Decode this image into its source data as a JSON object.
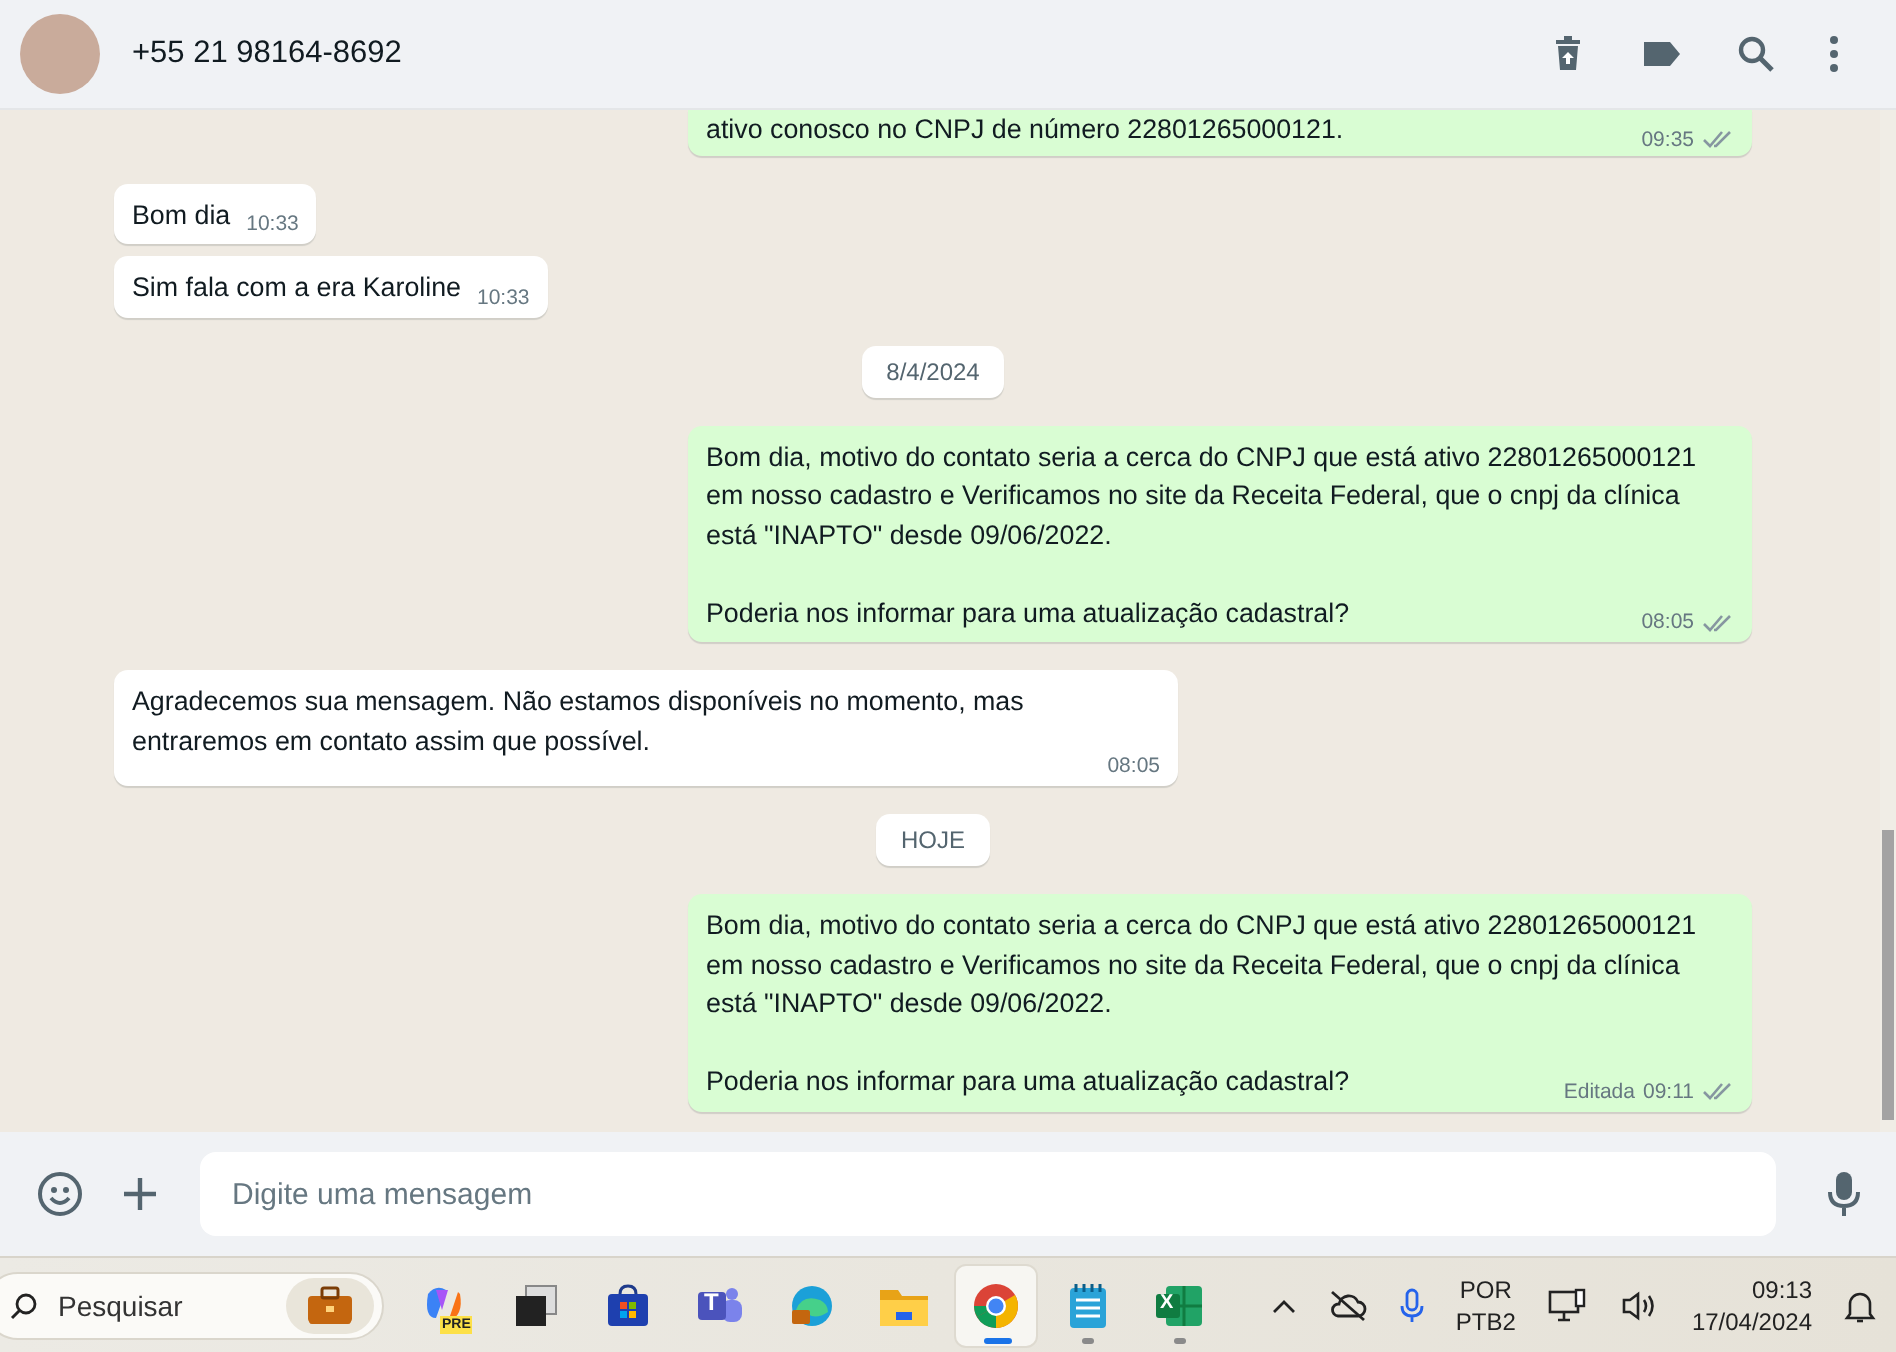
{
  "header": {
    "contact": "+55 21 98164-8692"
  },
  "messages": [
    {
      "kind": "out",
      "paragraphs": [
        "ativo conosco no CNPJ de número 22801265000121."
      ],
      "time": "09:35",
      "read": false
    },
    {
      "kind": "in",
      "paragraphs": [
        "Bom dia"
      ],
      "time": "10:33"
    },
    {
      "kind": "in",
      "paragraphs": [
        "Sim fala com a era Karoline"
      ],
      "time": "10:33"
    },
    {
      "kind": "date",
      "label": "8/4/2024"
    },
    {
      "kind": "out",
      "paragraphs": [
        "Bom dia, motivo do contato seria a cerca do CNPJ que está ativo 22801265000121 em nosso cadastro e Verificamos no site da Receita Federal, que o cnpj da clínica está \"INAPTO\" desde 09/06/2022.",
        "Poderia nos informar para uma atualização cadastral?"
      ],
      "time": "08:05",
      "read": false
    },
    {
      "kind": "in",
      "paragraphs": [
        "Agradecemos sua mensagem. Não estamos disponíveis no momento, mas entraremos em contato assim que possível."
      ],
      "time": "08:05"
    },
    {
      "kind": "date",
      "label": "HOJE"
    },
    {
      "kind": "out",
      "paragraphs": [
        "Bom dia, motivo do contato seria a cerca do CNPJ que está ativo 22801265000121 em nosso cadastro e Verificamos no site da Receita Federal, que o cnpj da clínica está \"INAPTO\" desde 09/06/2022.",
        "Poderia nos informar para uma atualização cadastral?"
      ],
      "edited": "Editada",
      "time": "09:11",
      "read": false
    }
  ],
  "composer": {
    "placeholder": "Digite uma mensagem"
  },
  "taskbar": {
    "search_placeholder": "Pesquisar",
    "apps": [
      {
        "kind": "copilot",
        "badge": "PRE",
        "selected": false,
        "running": false
      },
      {
        "kind": "windows",
        "selected": false,
        "running": false
      },
      {
        "kind": "store",
        "selected": false,
        "running": false
      },
      {
        "kind": "teams",
        "badge": "T",
        "selected": false,
        "running": false
      },
      {
        "kind": "edge",
        "selected": false,
        "running": false
      },
      {
        "kind": "folder",
        "selected": false,
        "running": false
      },
      {
        "kind": "chrome",
        "selected": true,
        "running": true
      },
      {
        "kind": "notepad",
        "selected": false,
        "running": true
      },
      {
        "kind": "excel",
        "badge": "X",
        "selected": false,
        "running": true
      }
    ],
    "language": "POR",
    "layout": "PTB2",
    "time": "09:13",
    "date": "17/04/2024"
  }
}
